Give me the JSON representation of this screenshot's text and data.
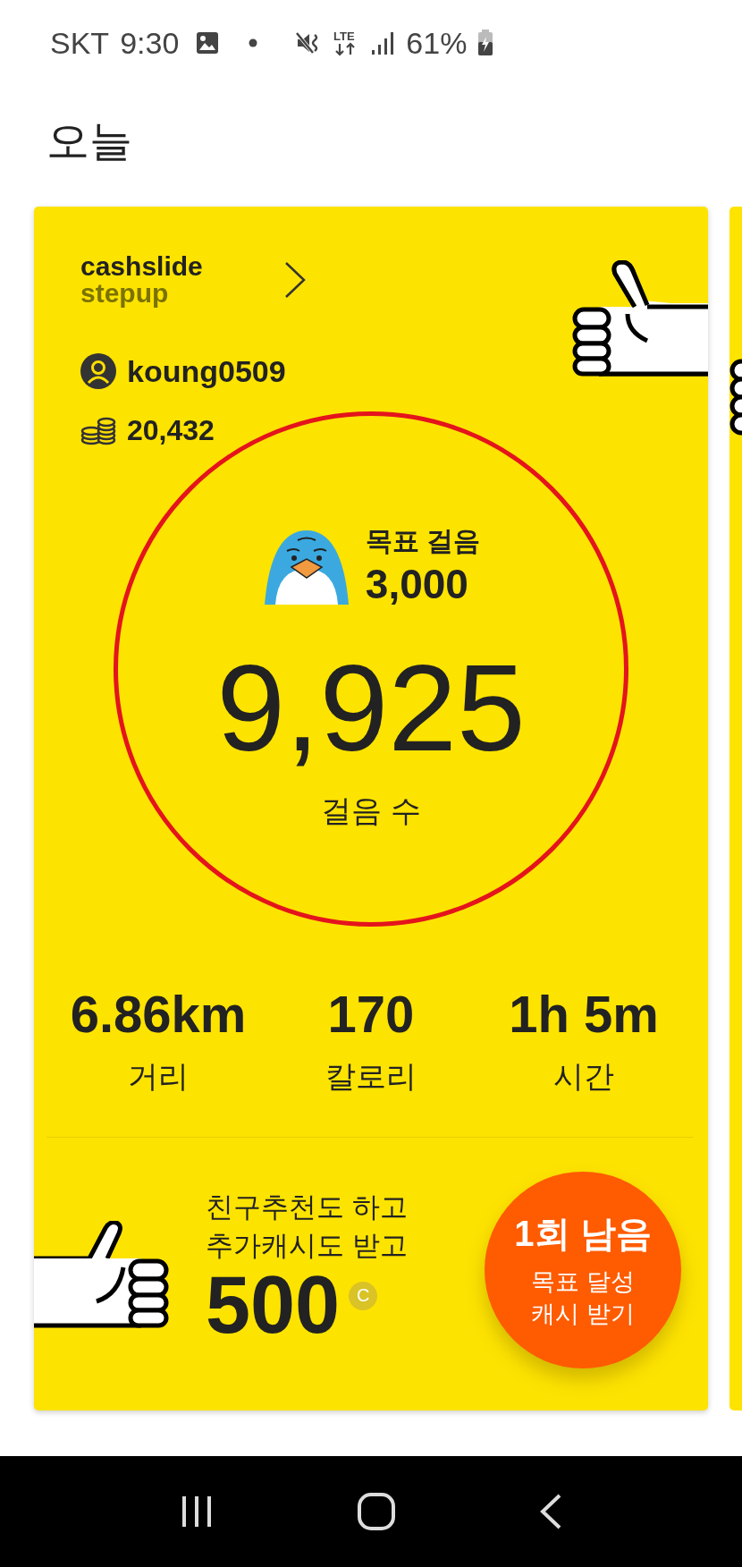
{
  "status_bar": {
    "carrier": "SKT",
    "time": "9:30",
    "network": "LTE",
    "battery": "61%"
  },
  "page_title": "오늘",
  "card": {
    "brand": [
      "cashslide",
      "stepup"
    ],
    "username": "koung0509",
    "points": "20,432",
    "goal": {
      "label": "목표 걸음",
      "value": "3,000"
    },
    "steps": {
      "value": "9,925",
      "label": "걸음 수"
    },
    "stats": [
      {
        "value": "6.86km",
        "label": "거리"
      },
      {
        "value": "170",
        "label": "칼로리"
      },
      {
        "value": "1h 5m",
        "label": "시간"
      }
    ],
    "promo": {
      "lines": [
        "친구추천도 하고",
        "추가캐시도 받고"
      ],
      "amount": "500",
      "currency": "C"
    },
    "action": {
      "title": "1회 남음",
      "lines": [
        "목표 달성",
        "캐시 받기"
      ]
    }
  }
}
